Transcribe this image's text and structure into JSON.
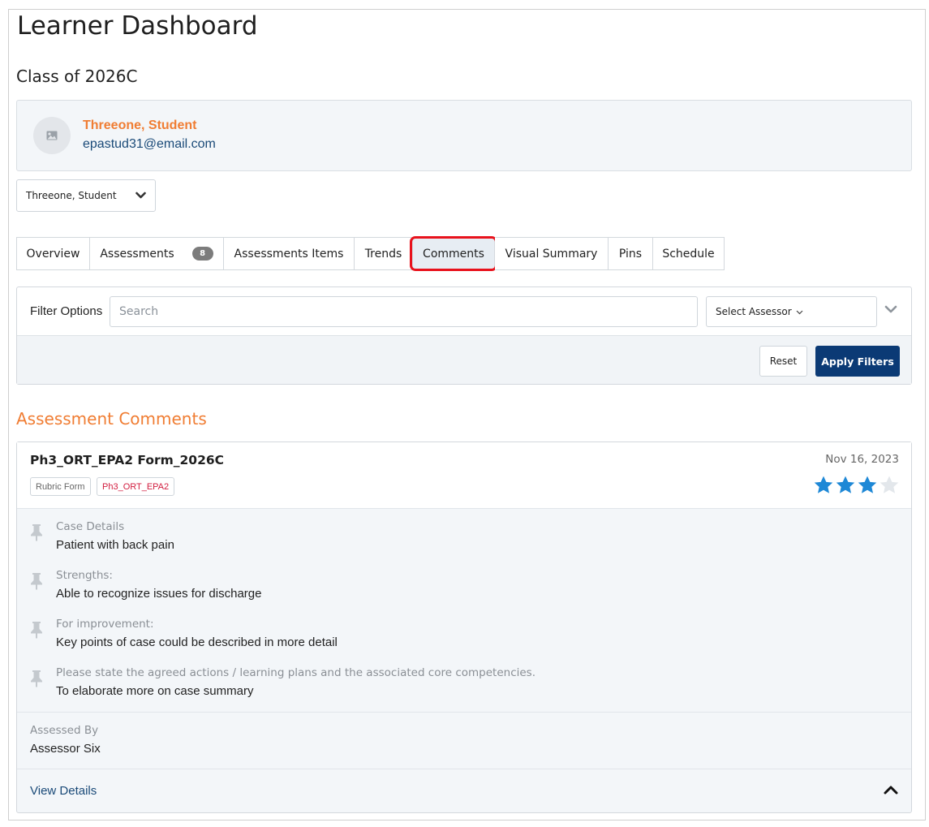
{
  "header": {
    "title": "Learner Dashboard",
    "class_title": "Class of 2026C"
  },
  "student": {
    "name": "Threeone, Student",
    "email": "epastud31@email.com",
    "avatar_icon": "image-icon",
    "selector_value": "Threeone, Student"
  },
  "tabs": [
    {
      "label": "Overview"
    },
    {
      "label": "Assessments",
      "badge": "8"
    },
    {
      "label": "Assessments Items"
    },
    {
      "label": "Trends"
    },
    {
      "label": "Comments",
      "active": true
    },
    {
      "label": "Visual Summary"
    },
    {
      "label": "Pins"
    },
    {
      "label": "Schedule"
    }
  ],
  "filters": {
    "label": "Filter Options",
    "search_placeholder": "Search",
    "assessor_select": "Select Assessor",
    "reset_label": "Reset",
    "apply_label": "Apply Filters"
  },
  "comments_section": {
    "title": "Assessment Comments",
    "card": {
      "form_title": "Ph3_ORT_EPA2 Form_2026C",
      "tags": [
        "Rubric Form",
        "Ph3_ORT_EPA2"
      ],
      "date": "Nov 16, 2023",
      "rating": 3,
      "rating_max": 4,
      "items": [
        {
          "label": "Case Details",
          "text": "Patient with back pain"
        },
        {
          "label": "Strengths:",
          "text": "Able to recognize issues for discharge"
        },
        {
          "label": "For improvement:",
          "text": "Key points of case could be described in more detail"
        },
        {
          "label": "Please state the agreed actions / learning plans and the associated core competencies.",
          "text": "To elaborate more on case summary"
        }
      ],
      "assessed_by_label": "Assessed By",
      "assessed_by": "Assessor Six",
      "view_details_label": "View Details"
    }
  },
  "colors": {
    "accent_orange": "#f07d33",
    "primary_navy": "#0b3a75",
    "link_blue": "#1a4a78",
    "star_filled": "#1e88d6",
    "star_empty": "#e3e7eb",
    "tag_red": "#d21d3f",
    "highlight_red": "#e8121c"
  }
}
